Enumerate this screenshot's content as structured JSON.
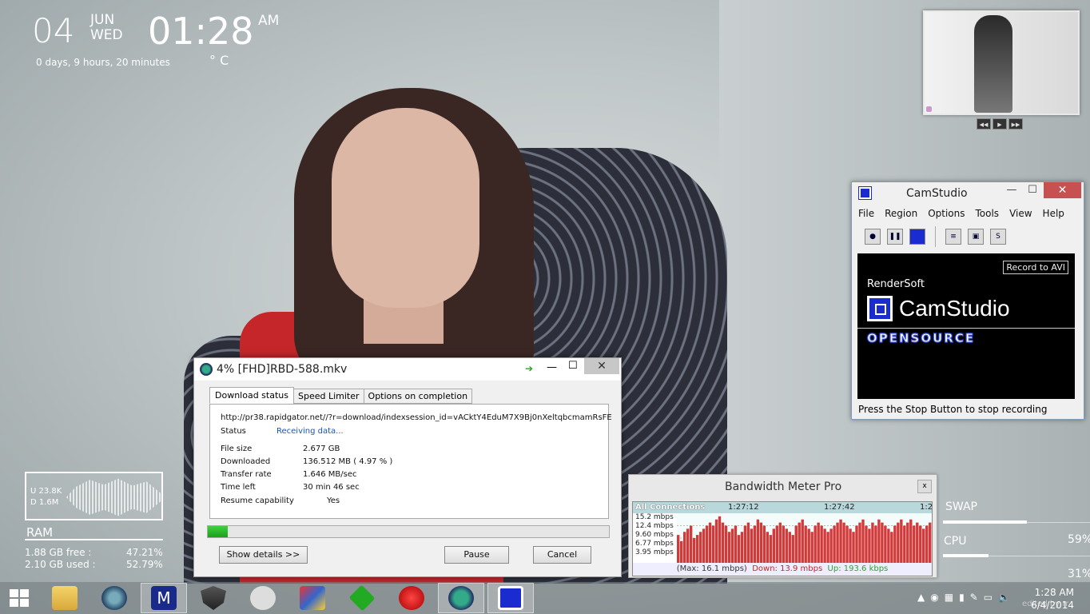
{
  "clock": {
    "day": "04",
    "month": "JUN",
    "weekday": "WED",
    "time": "01:28",
    "ampm": "AM",
    "uptime": "0 days, 9 hours, 20 minutes",
    "temp": "° C"
  },
  "thumbnail": {
    "controls": [
      "◀◀",
      "▶",
      "▶▶"
    ]
  },
  "camstudio": {
    "title": "CamStudio",
    "menu": [
      "File",
      "Region",
      "Options",
      "Tools",
      "View",
      "Help"
    ],
    "record_label": "Record to AVI",
    "brand": "RenderSoft",
    "logo_text": "CamStudio",
    "opensource": "OPENSOURCE",
    "status": "Press the Stop Button to stop recording"
  },
  "download": {
    "title": "4% [FHD]RBD-588.mkv",
    "tabs": [
      "Download status",
      "Speed Limiter",
      "Options on completion"
    ],
    "url": "http://pr38.rapidgator.net//?r=download/indexsession_id=vACktY4EduM7X9Bj0nXeltqbcmamRsFE",
    "status_label": "Status",
    "status_value": "Receiving data...",
    "rows": [
      {
        "label": "File size",
        "value": "2.677  GB"
      },
      {
        "label": "Downloaded",
        "value": "136.512  MB  ( 4.97 % )"
      },
      {
        "label": "Transfer rate",
        "value": "1.646  MB/sec"
      },
      {
        "label": "Time left",
        "value": "30 min 46 sec"
      },
      {
        "label": "Resume capability",
        "value": "Yes"
      }
    ],
    "progress": 0.0497,
    "show_details": "Show details >>",
    "pause": "Pause",
    "cancel": "Cancel"
  },
  "bandwidth": {
    "title": "Bandwidth Meter Pro",
    "close": "x",
    "header": "All Connections",
    "times": [
      "1:27:12",
      "1:27:42",
      "1:2"
    ],
    "ylabels": [
      "15.2 mbps",
      "12.4 mbps",
      "9.60 mbps",
      "6.77 mbps",
      "3.95 mbps"
    ],
    "max_text": "(Max: 16.1 mbps)",
    "down_text": "Down: 13.9 mbps",
    "up_text": "Up: 193.6 kbps",
    "bars": [
      9,
      7,
      10,
      11,
      12,
      8,
      9,
      10,
      11,
      12,
      13,
      12,
      14,
      15,
      13,
      12,
      10,
      11,
      12,
      9,
      10,
      12,
      13,
      11,
      12,
      14,
      13,
      12,
      10,
      9,
      11,
      12,
      13,
      12,
      11,
      10,
      9,
      12,
      13,
      14,
      12,
      11,
      10,
      12,
      13,
      12,
      11,
      10,
      11,
      12,
      13,
      14,
      13,
      12,
      11,
      10,
      12,
      13,
      14,
      12,
      11,
      13,
      12,
      14,
      13,
      12,
      11,
      10,
      12,
      13,
      14,
      12,
      13,
      14,
      12,
      13,
      12,
      11,
      12,
      13
    ]
  },
  "netmeter": {
    "up": "U  23.8K",
    "down": "D  1.6M"
  },
  "ram": {
    "label": "RAM",
    "free_text": "1.88 GB free :",
    "free_pct": "47.21%",
    "used_text": "2.10 GB used :",
    "used_pct": "52.79%"
  },
  "swap": {
    "label": "SWAP"
  },
  "cpu": {
    "label": "CPU",
    "pct": "59%",
    "pct2": "31%"
  },
  "taskbar": {
    "apps": [
      "file-explorer",
      "browser",
      "malwarebytes",
      "shield-app",
      "network-app",
      "paint-app",
      "green-app",
      "apple-app",
      "idm",
      "camstudio"
    ],
    "time": "1:28 AM",
    "date": "6/4/2014",
    "watermark": "edited by rr"
  }
}
